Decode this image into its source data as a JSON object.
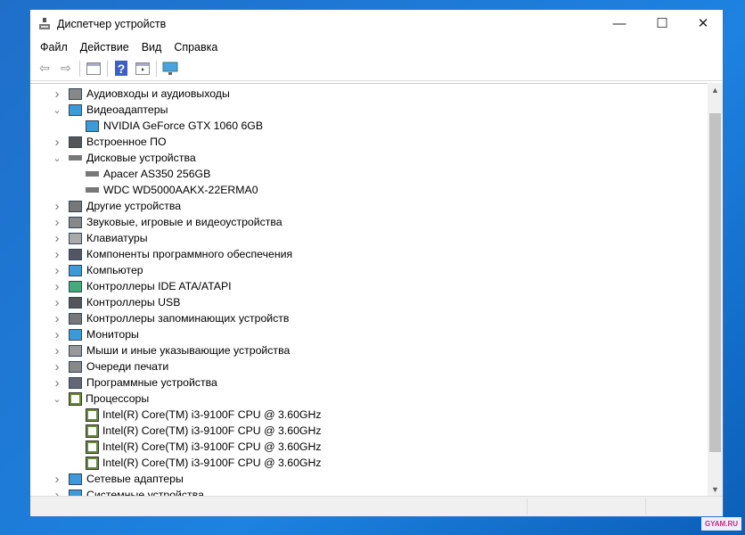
{
  "window": {
    "title": "Диспетчер устройств",
    "minimize": "—",
    "maximize": "☐",
    "close": "✕"
  },
  "menu": [
    "Файл",
    "Действие",
    "Вид",
    "Справка"
  ],
  "toolbar": {
    "back": "⇦",
    "forward": "⇨",
    "help": "?"
  },
  "tree": [
    {
      "label": "Аудиовходы и аудиовыходы",
      "depth": 0,
      "state": "collapsed",
      "icon": "speaker-icon"
    },
    {
      "label": "Видеоадаптеры",
      "depth": 0,
      "state": "expanded",
      "icon": "display-adapter-icon"
    },
    {
      "label": "NVIDIA GeForce GTX 1060 6GB",
      "depth": 1,
      "icon": "display-adapter-icon"
    },
    {
      "label": "Встроенное ПО",
      "depth": 0,
      "state": "collapsed",
      "icon": "firmware-icon"
    },
    {
      "label": "Дисковые устройства",
      "depth": 0,
      "state": "expanded",
      "icon": "disk-icon"
    },
    {
      "label": "Apacer AS350 256GB",
      "depth": 1,
      "icon": "disk-icon"
    },
    {
      "label": "WDC WD5000AAKX-22ERMA0",
      "depth": 1,
      "icon": "disk-icon"
    },
    {
      "label": "Другие устройства",
      "depth": 0,
      "state": "collapsed",
      "icon": "unknown-device-icon"
    },
    {
      "label": "Звуковые, игровые и видеоустройства",
      "depth": 0,
      "state": "collapsed",
      "icon": "speaker-icon"
    },
    {
      "label": "Клавиатуры",
      "depth": 0,
      "state": "collapsed",
      "icon": "keyboard-icon"
    },
    {
      "label": "Компоненты программного обеспечения",
      "depth": 0,
      "state": "collapsed",
      "icon": "software-component-icon"
    },
    {
      "label": "Компьютер",
      "depth": 0,
      "state": "collapsed",
      "icon": "computer-icon"
    },
    {
      "label": "Контроллеры IDE ATA/ATAPI",
      "depth": 0,
      "state": "collapsed",
      "icon": "ide-controller-icon"
    },
    {
      "label": "Контроллеры USB",
      "depth": 0,
      "state": "collapsed",
      "icon": "usb-icon"
    },
    {
      "label": "Контроллеры запоминающих устройств",
      "depth": 0,
      "state": "collapsed",
      "icon": "storage-controller-icon"
    },
    {
      "label": "Мониторы",
      "depth": 0,
      "state": "collapsed",
      "icon": "monitor-icon"
    },
    {
      "label": "Мыши и иные указывающие устройства",
      "depth": 0,
      "state": "collapsed",
      "icon": "mouse-icon"
    },
    {
      "label": "Очереди печати",
      "depth": 0,
      "state": "collapsed",
      "icon": "printer-icon"
    },
    {
      "label": "Программные устройства",
      "depth": 0,
      "state": "collapsed",
      "icon": "software-device-icon"
    },
    {
      "label": "Процессоры",
      "depth": 0,
      "state": "expanded",
      "icon": "cpu-icon"
    },
    {
      "label": "Intel(R) Core(TM) i3-9100F CPU @ 3.60GHz",
      "depth": 1,
      "icon": "cpu-icon"
    },
    {
      "label": "Intel(R) Core(TM) i3-9100F CPU @ 3.60GHz",
      "depth": 1,
      "icon": "cpu-icon"
    },
    {
      "label": "Intel(R) Core(TM) i3-9100F CPU @ 3.60GHz",
      "depth": 1,
      "icon": "cpu-icon"
    },
    {
      "label": "Intel(R) Core(TM) i3-9100F CPU @ 3.60GHz",
      "depth": 1,
      "icon": "cpu-icon"
    },
    {
      "label": "Сетевые адаптеры",
      "depth": 0,
      "state": "collapsed",
      "icon": "network-adapter-icon"
    },
    {
      "label": "Системные устройства",
      "depth": 0,
      "state": "collapsed",
      "icon": "system-device-icon"
    }
  ],
  "watermark": "GYAM.RU",
  "colors": {
    "accent": "#2a74c8",
    "desktop": "#1d82e0"
  }
}
